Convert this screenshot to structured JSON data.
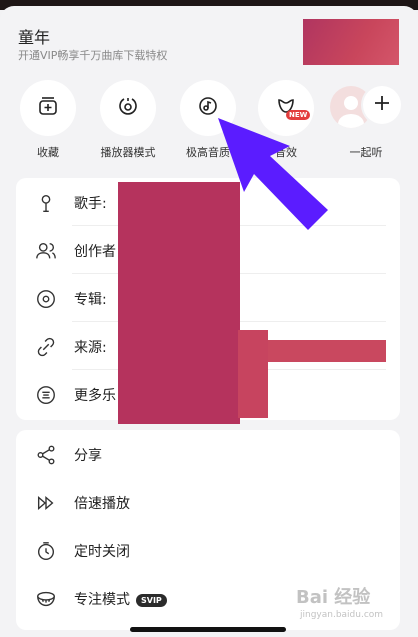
{
  "song": {
    "title": "童年",
    "subtitle": "开通VIP畅享千万曲库下载特权"
  },
  "quick_actions": [
    {
      "label": "收藏",
      "icon": "favorite-add-icon"
    },
    {
      "label": "播放器模式",
      "icon": "player-mode-icon"
    },
    {
      "label": "极高音质",
      "icon": "hq-sound-icon"
    },
    {
      "label": "音效",
      "icon": "sound-effect-icon",
      "badge": "NEW"
    },
    {
      "label": "一起听",
      "icon": "listen-together-icon"
    }
  ],
  "info_rows": [
    {
      "label": "歌手:",
      "icon": "singer-icon"
    },
    {
      "label": "创作者",
      "icon": "creator-icon"
    },
    {
      "label": "专辑:",
      "icon": "album-icon"
    },
    {
      "label": "来源:",
      "icon": "source-icon"
    },
    {
      "label": "更多乐",
      "icon": "score-icon"
    }
  ],
  "action_rows": [
    {
      "label": "分享",
      "icon": "share-icon"
    },
    {
      "label": "倍速播放",
      "icon": "speed-icon"
    },
    {
      "label": "定时关闭",
      "icon": "timer-icon"
    },
    {
      "label": "专注模式",
      "icon": "focus-mode-icon",
      "badge": "SVIP"
    }
  ],
  "watermark": {
    "main": "Bai 经验",
    "sub": "jingyan.baidu.com"
  },
  "colors": {
    "accent_arrow": "#5b1cff",
    "redaction": "#b5335d",
    "new_badge": "#e33d3d"
  }
}
